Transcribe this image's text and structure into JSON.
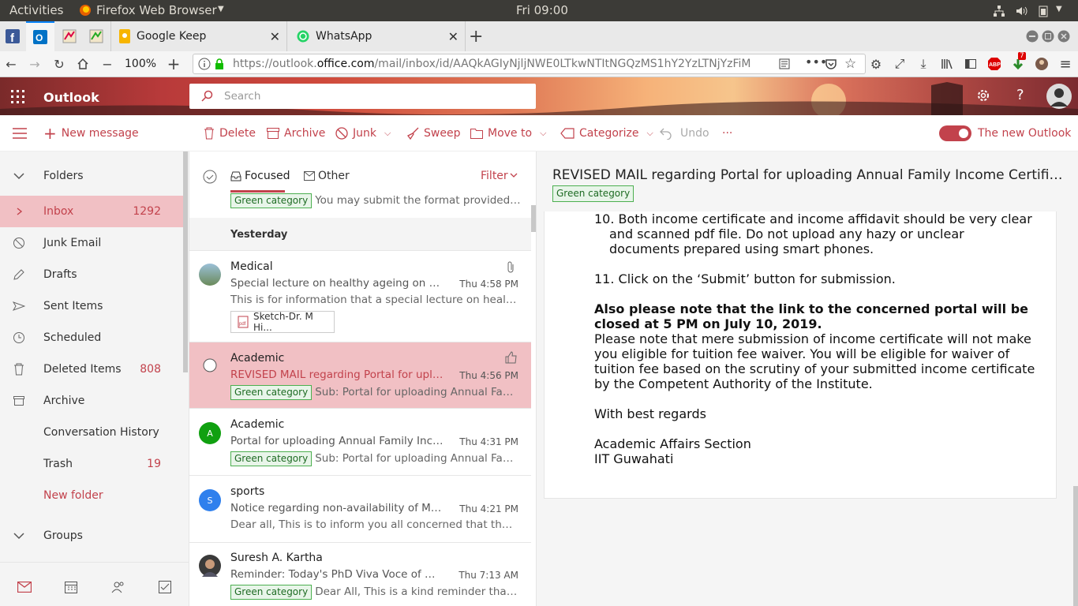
{
  "gnome": {
    "activities": "Activities",
    "app": "Firefox Web Browser",
    "clock": "Fri 09:00"
  },
  "tabs": [
    {
      "label": "Google Keep"
    },
    {
      "label": "WhatsApp"
    }
  ],
  "nav": {
    "zoom": "100%",
    "url_prefix": "https://outlook.",
    "url_domain": "office.com",
    "url_rest": "/mail/inbox/id/AAQkAGIyNjljNWE0LTkwNTItNGQzMS1hY2YzLTNjYzFiM",
    "abp_badge": "7"
  },
  "outlook": {
    "app_name": "Outlook",
    "search_placeholder": "Search"
  },
  "commands": {
    "new_message": "New message",
    "delete": "Delete",
    "archive": "Archive",
    "junk": "Junk",
    "sweep": "Sweep",
    "move_to": "Move to",
    "categorize": "Categorize",
    "undo": "Undo",
    "more": "···",
    "new_outlook": "The new Outlook"
  },
  "folders": {
    "header": "Folders",
    "items": [
      {
        "name": "Inbox",
        "count": "1292"
      },
      {
        "name": "Junk Email",
        "count": ""
      },
      {
        "name": "Drafts",
        "count": ""
      },
      {
        "name": "Sent Items",
        "count": ""
      },
      {
        "name": "Scheduled",
        "count": ""
      },
      {
        "name": "Deleted Items",
        "count": "808"
      },
      {
        "name": "Archive",
        "count": ""
      },
      {
        "name": "Conversation History",
        "count": ""
      },
      {
        "name": "Trash",
        "count": "19"
      }
    ],
    "new_folder": "New folder",
    "groups": "Groups"
  },
  "list": {
    "focused": "Focused",
    "other": "Other",
    "filter": "Filter",
    "top_preview": "You may submit the format provided by t...",
    "group_label": "Yesterday",
    "messages": [
      {
        "sender": "Medical",
        "subject": "Special lecture on healthy ageing on 27th ...",
        "time": "Thu 4:58 PM",
        "preview": "This is for information that a special lecture on healthy ag...",
        "attachment": "Sketch-Dr. M Hi...",
        "tag": ""
      },
      {
        "sender": "Academic",
        "subject": "REVISED MAIL regarding Portal for upload...",
        "time": "Thu 4:56 PM",
        "preview": "Sub: Portal for uploading Annual Family In...",
        "tag": "Green category"
      },
      {
        "sender": "Academic",
        "subject": "Portal for uploading Annual Family Income...",
        "time": "Thu 4:31 PM",
        "preview": "Sub: Portal for uploading Annual Family In...",
        "tag": "Green category",
        "initial": "A"
      },
      {
        "sender": "sports",
        "subject": "Notice regarding non-availability of Multip...",
        "time": "Thu 4:21 PM",
        "preview": "Dear all, This is to inform you all concerned that the Tenni...",
        "tag": "",
        "initial": "S"
      },
      {
        "sender": "Suresh A. Kartha",
        "subject": "Reminder: Today's PhD Viva Voce of Mr. R....",
        "time": "Thu 7:13 AM",
        "preview": "Dear All, This is a kind reminder that Mr. R....",
        "tag": "Green category"
      }
    ],
    "tag_label": "Green category"
  },
  "reading": {
    "subject": "REVISED MAIL regarding Portal for uploading Annual Family Income Certificate to ...",
    "category": "Green category",
    "p10a": "10.  Both income certificate and income affidavit should be very clear",
    "p10b": "and scanned pdf file. Do not upload any hazy or unclear",
    "p10c": "documents prepared using smart phones.",
    "p11": "11. Click on the ‘Submit’ button for submission.",
    "bold1": "Also please note that the link to the concerned portal will be",
    "bold2": "closed at 5 PM on July 10, 2019.",
    "n1": "Please note that mere submission of income certificate will not make",
    "n2": "you eligible for tuition fee waiver. You will be eligible for waiver of",
    "n3": "tuition fee based on the scrutiny of your submitted income certificate",
    "n4": "by the Competent Authority of the Institute.",
    "regards": "With best regards",
    "sig1": "Academic Affairs Section",
    "sig2": "IIT Guwahati"
  },
  "colors": {
    "accent": "#c2424c",
    "selected": "#f1c0c4",
    "tag_green": "#4caf50"
  }
}
